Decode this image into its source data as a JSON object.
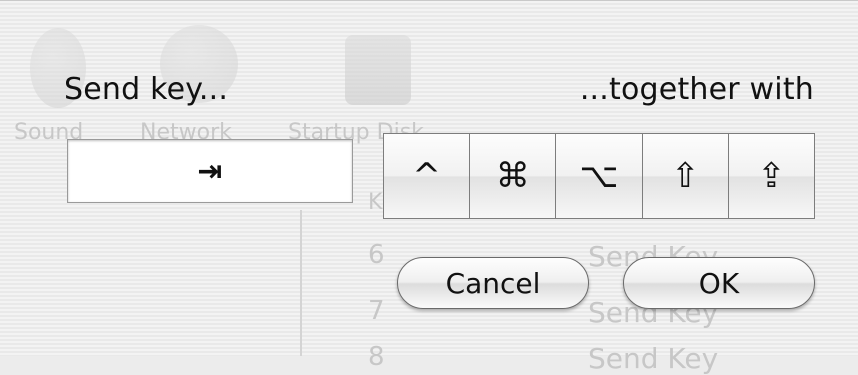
{
  "background_window": {
    "toolbar_labels": [
      "Sound",
      "Network",
      "Startup Disk"
    ],
    "row_numbers": [
      "6",
      "7",
      "8"
    ],
    "row_actions": [
      "Send Key",
      "Send Key",
      "Send Key"
    ],
    "column_header": "K"
  },
  "dialog": {
    "send_key_label": "Send key...",
    "together_with_label": "...together with",
    "key_field_value": "⇥"
  },
  "modifiers": [
    {
      "name": "control",
      "symbol": "^"
    },
    {
      "name": "command",
      "symbol": "⌘"
    },
    {
      "name": "option",
      "symbol": "⌥"
    },
    {
      "name": "shift",
      "symbol": "⇧"
    },
    {
      "name": "caps-lock",
      "symbol": "⇪"
    }
  ],
  "buttons": {
    "cancel": "Cancel",
    "ok": "OK"
  }
}
